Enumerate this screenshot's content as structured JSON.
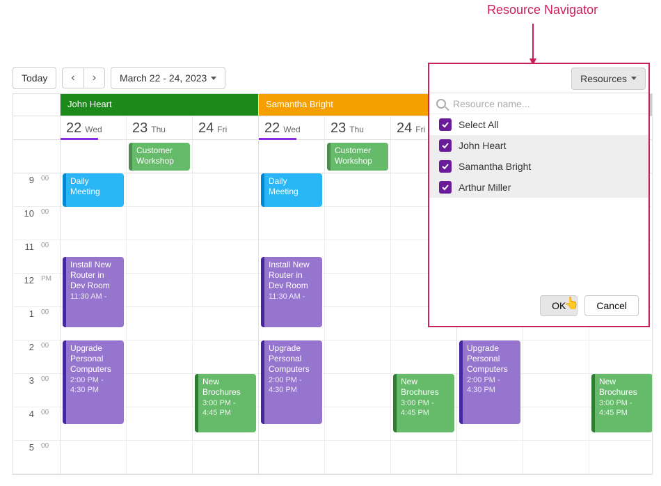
{
  "annotation": {
    "label": "Resource Navigator"
  },
  "toolbar": {
    "today": "Today",
    "date_range": "March 22 - 24, 2023",
    "resources_button": "Resources"
  },
  "hours": [
    {
      "label": "9",
      "suffix": "00"
    },
    {
      "label": "10",
      "suffix": "00"
    },
    {
      "label": "11",
      "suffix": "00"
    },
    {
      "label": "12",
      "suffix": "PM"
    },
    {
      "label": "1",
      "suffix": "00"
    },
    {
      "label": "2",
      "suffix": "00"
    },
    {
      "label": "3",
      "suffix": "00"
    },
    {
      "label": "4",
      "suffix": "00"
    },
    {
      "label": "5",
      "suffix": "00"
    }
  ],
  "days": [
    {
      "num": "22",
      "dow": "Wed"
    },
    {
      "num": "23",
      "dow": "Thu"
    },
    {
      "num": "24",
      "dow": "Fri"
    }
  ],
  "resources": [
    {
      "name": "John Heart",
      "color": "#1b8a1b"
    },
    {
      "name": "Samantha Bright",
      "color": "#f5a000"
    },
    {
      "name": "Arthur Miller",
      "color": "#cccccc"
    }
  ],
  "events": {
    "daily_meeting": {
      "title": "Daily Meeting"
    },
    "customer_workshop": {
      "title": "Customer Workshop"
    },
    "install_router": {
      "title": "Install New Router in Dev Room",
      "time": "11:30 AM -"
    },
    "install_router_short": {
      "title": "Dev Room",
      "time": "11:30 AM -"
    },
    "upgrade_pcs": {
      "title": "Upgrade Personal Computers",
      "time": "2:00 PM - 4:30 PM"
    },
    "new_brochures": {
      "title": "New Brochures",
      "time": "3:00 PM - 4:45 PM"
    }
  },
  "navigator": {
    "placeholder": "Resource name...",
    "select_all": "Select All",
    "items": [
      {
        "label": "John Heart"
      },
      {
        "label": "Samantha Bright"
      },
      {
        "label": "Arthur Miller"
      }
    ],
    "ok": "OK",
    "cancel": "Cancel"
  }
}
